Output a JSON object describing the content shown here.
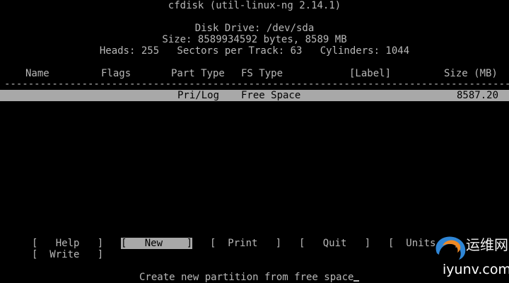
{
  "app": {
    "title": "cfdisk (util-linux-ng 2.14.1)"
  },
  "disk": {
    "drive": "Disk Drive: /dev/sda",
    "size": "Size: 8589934592 bytes, 8589 MB",
    "geometry": "Heads: 255   Sectors per Track: 63   Cylinders: 1044"
  },
  "table": {
    "headers": {
      "name": "Name",
      "flags": "Flags",
      "part_type": "Part Type",
      "fs_type": "FS Type",
      "label": "[Label]",
      "size": "Size (MB)"
    },
    "separator": "------------------------------------------------------------------------------------------",
    "rows": [
      {
        "name": "",
        "flags": "",
        "part_type": "Pri/Log",
        "fs_type": "Free Space",
        "label": "",
        "size": "8587.20",
        "selected": true
      }
    ]
  },
  "menu": {
    "items": [
      {
        "label": "[   Help   ]",
        "active": false
      },
      {
        "label": "[   New    ]",
        "active": true
      },
      {
        "label": "[  Print   ]",
        "active": false
      },
      {
        "label": "[   Quit   ]",
        "active": false
      },
      {
        "label": "[  Units   ]",
        "active": false
      },
      {
        "label": "[  Write   ]",
        "active": false
      }
    ]
  },
  "status": {
    "text": "Create new partition from free space"
  },
  "watermark": {
    "cn": "运维网",
    "en": "iyunv.com",
    "colors": {
      "swirl_blue": "#2f86d6",
      "swirl_orange": "#f08a24"
    }
  }
}
